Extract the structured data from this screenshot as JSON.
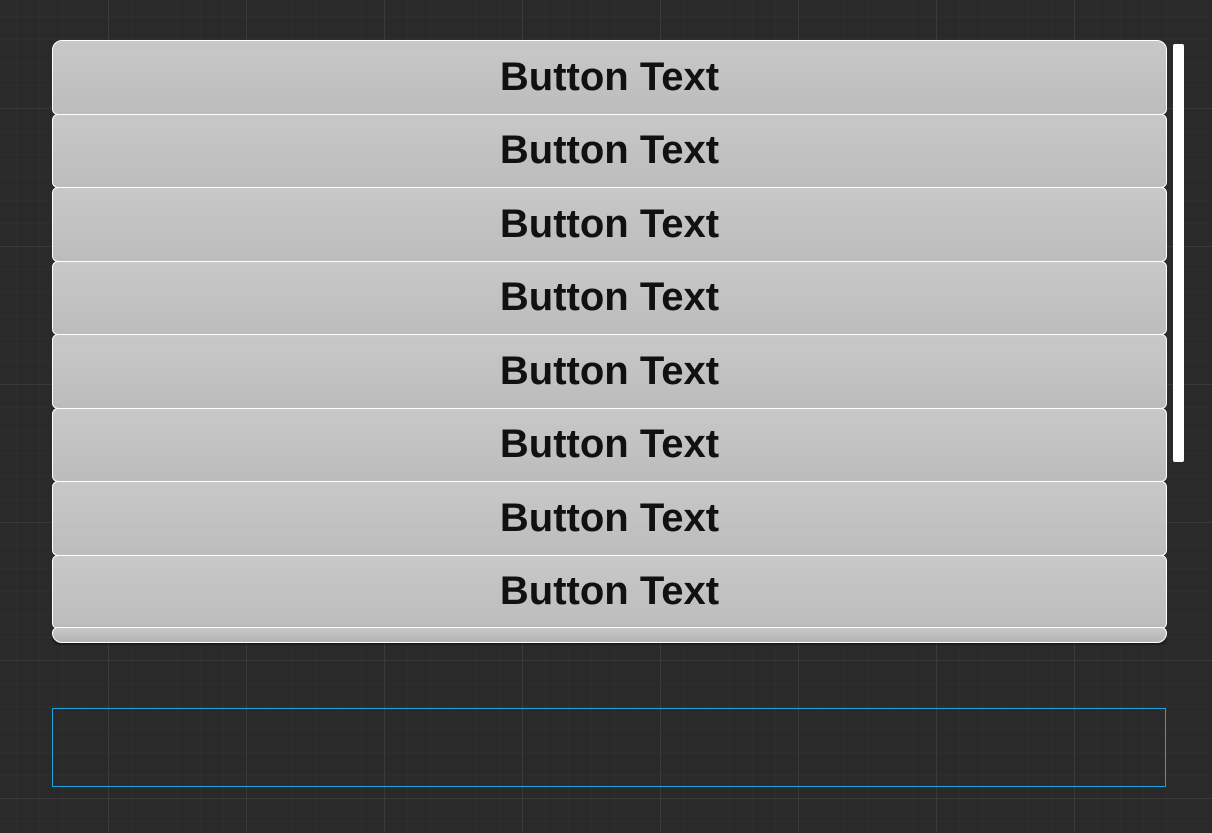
{
  "scrollview": {
    "buttons": [
      {
        "label": "Button Text"
      },
      {
        "label": "Button Text"
      },
      {
        "label": "Button Text"
      },
      {
        "label": "Button Text"
      },
      {
        "label": "Button Text"
      },
      {
        "label": "Button Text"
      },
      {
        "label": "Button Text"
      },
      {
        "label": "Button Text"
      }
    ]
  },
  "colors": {
    "selection_border": "#1fa4e0",
    "button_face": "#c2c2c2",
    "button_border": "#ffffff",
    "grid_bg": "#2a2a2a"
  }
}
